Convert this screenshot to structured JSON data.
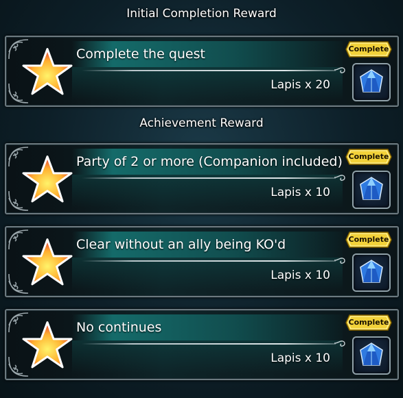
{
  "sections": {
    "initial_title": "Initial Completion Reward",
    "achievement_title": "Achievement Reward"
  },
  "rewards": [
    {
      "quest": "Complete the quest",
      "reward": "Lapis x 20",
      "status": "Complete"
    },
    {
      "quest": "Party of 2 or more (Companion included)",
      "reward": "Lapis x 10",
      "status": "Complete"
    },
    {
      "quest": "Clear without an ally being KO'd",
      "reward": "Lapis x 10",
      "status": "Complete"
    },
    {
      "quest": "No continues",
      "reward": "Lapis x 10",
      "status": "Complete"
    }
  ],
  "icons": {
    "quest": "star-icon",
    "reward": "lapis-gem-icon"
  },
  "colors": {
    "badge_gold": "#f2d23a",
    "band_teal": "#167878",
    "star_red": "#e8433a",
    "star_yellow": "#ffe34a"
  }
}
